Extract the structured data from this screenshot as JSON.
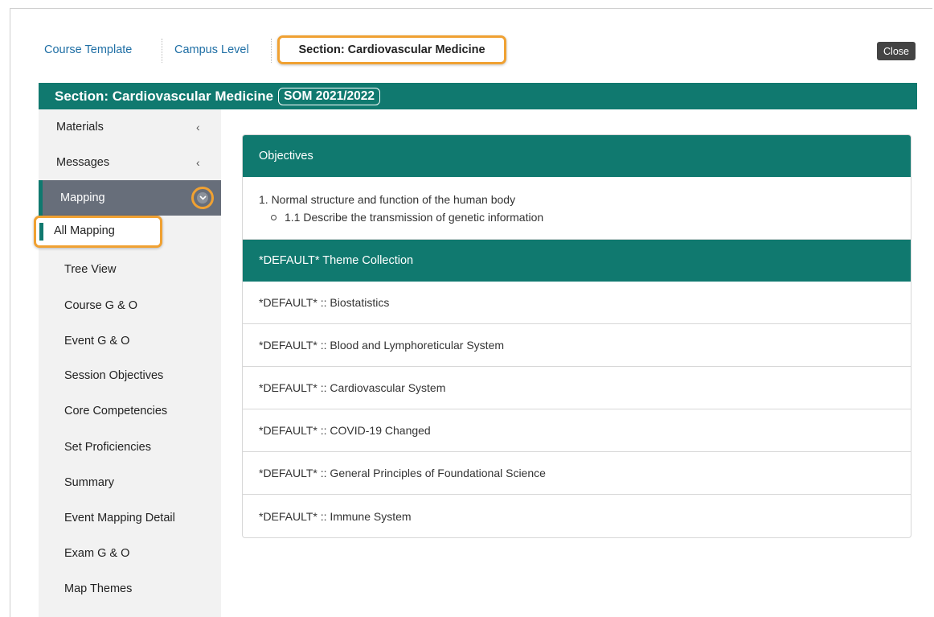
{
  "tabs": {
    "course_template": "Course Template",
    "campus_level": "Campus Level",
    "section": "Section: Cardiovascular Medicine"
  },
  "close_label": "Close",
  "banner": {
    "title": "Section: Cardiovascular Medicine",
    "year_badge": "SOM 2021/2022"
  },
  "sidenav": {
    "materials": "Materials",
    "messages": "Messages",
    "mapping": "Mapping",
    "chevron": "‹",
    "sub_items": [
      "All Mapping",
      "Tree View",
      "Course G & O",
      "Event G & O",
      "Session Objectives",
      "Core Competencies",
      "Set Proficiencies",
      "Summary",
      "Event Mapping Detail",
      "Exam G & O",
      "Map Themes"
    ]
  },
  "content": {
    "objectives_header": "Objectives",
    "objective_1": "1. Normal structure and function of the human body",
    "objective_1_1": "1.1 Describe the transmission of genetic information",
    "theme_header": "*DEFAULT* Theme Collection",
    "themes": [
      "*DEFAULT* :: Biostatistics",
      "*DEFAULT* :: Blood and Lymphoreticular System",
      "*DEFAULT* :: Cardiovascular System",
      "*DEFAULT* :: COVID-19 Changed",
      "*DEFAULT* :: General Principles of Foundational Science",
      "*DEFAULT* :: Immune System"
    ]
  },
  "colors": {
    "accent_teal": "#10796f",
    "highlight_orange": "#f0a132",
    "nav_active": "#676e7a"
  }
}
